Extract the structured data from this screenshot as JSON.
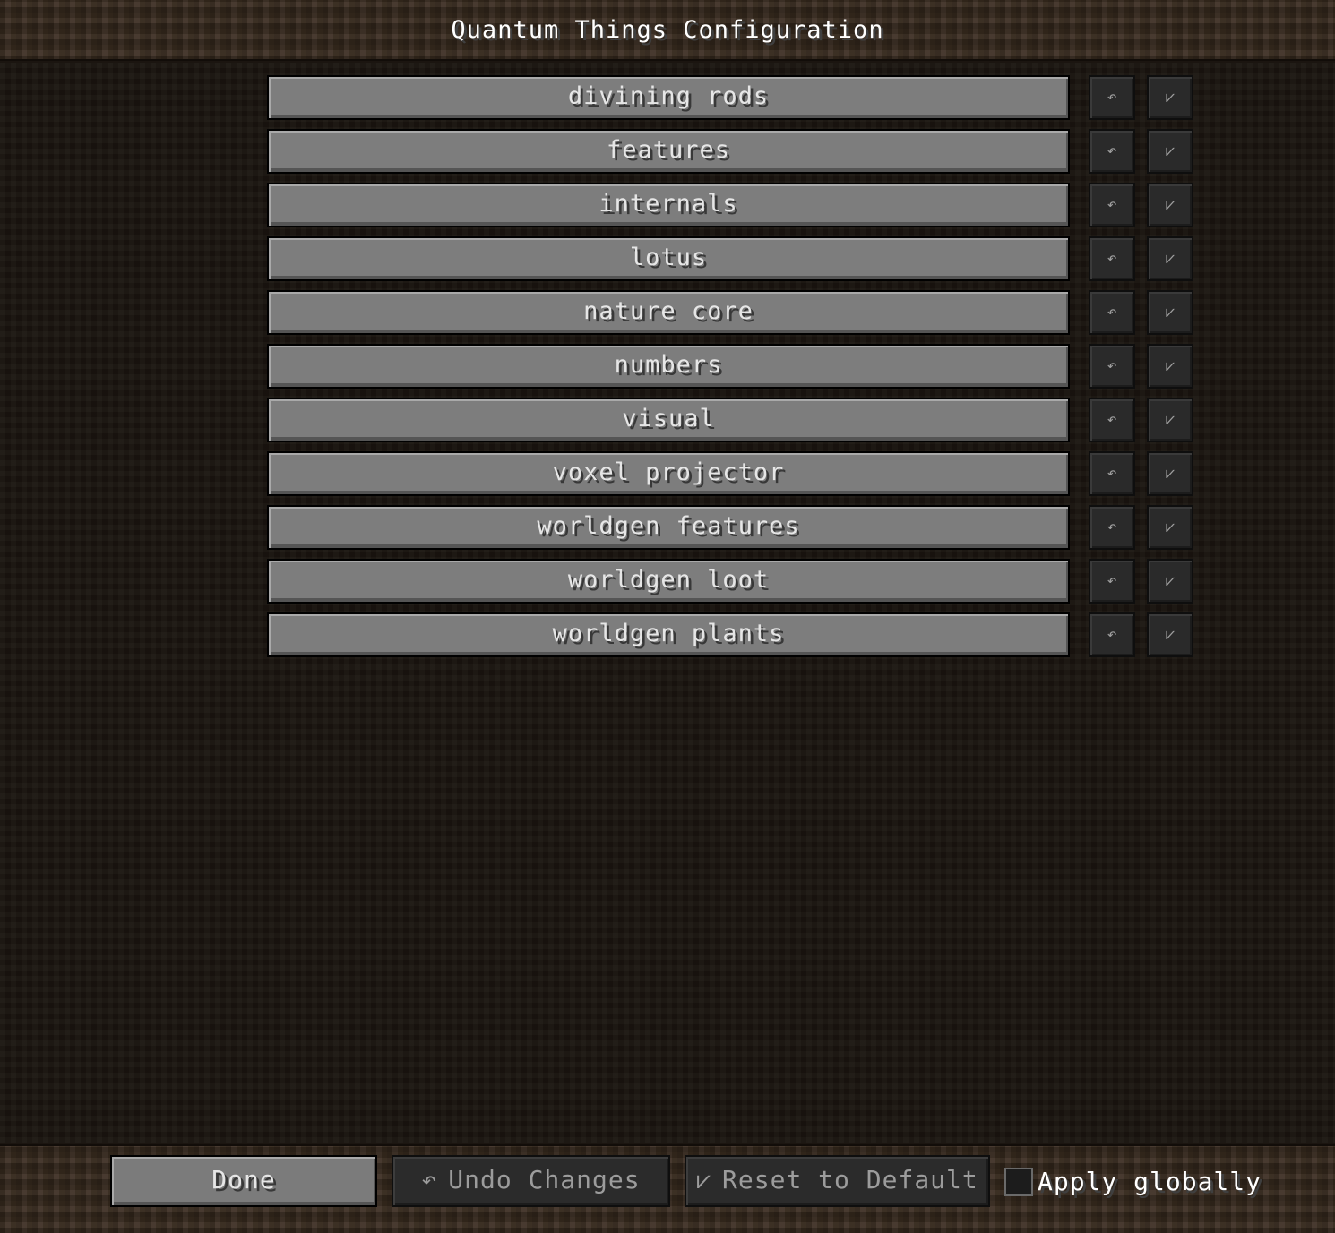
{
  "header": {
    "title": "Quantum Things Configuration"
  },
  "categories": [
    {
      "label": "divining rods"
    },
    {
      "label": "features"
    },
    {
      "label": "internals"
    },
    {
      "label": "lotus"
    },
    {
      "label": "nature core"
    },
    {
      "label": "numbers"
    },
    {
      "label": "visual"
    },
    {
      "label": "voxel projector"
    },
    {
      "label": "worldgen features"
    },
    {
      "label": "worldgen loot"
    },
    {
      "label": "worldgen plants"
    }
  ],
  "row_controls": {
    "undo_icon": "↶",
    "reset_icon": "⩗",
    "undo_icon_name": "undo-icon",
    "reset_icon_name": "reset-icon"
  },
  "footer": {
    "done_label": "Done",
    "undo_icon": "↶",
    "undo_label": "Undo Changes",
    "reset_icon": "⩗",
    "reset_label": "Reset to Default",
    "apply_globally_label": "Apply globally",
    "apply_globally_checked": false
  },
  "colors": {
    "button_enabled_bg": "#7d7d7d",
    "button_disabled_bg": "#2a2a2a",
    "title_text": "#ffffff",
    "button_text": "#e6e6e6",
    "disabled_text": "#9c9c9c"
  }
}
